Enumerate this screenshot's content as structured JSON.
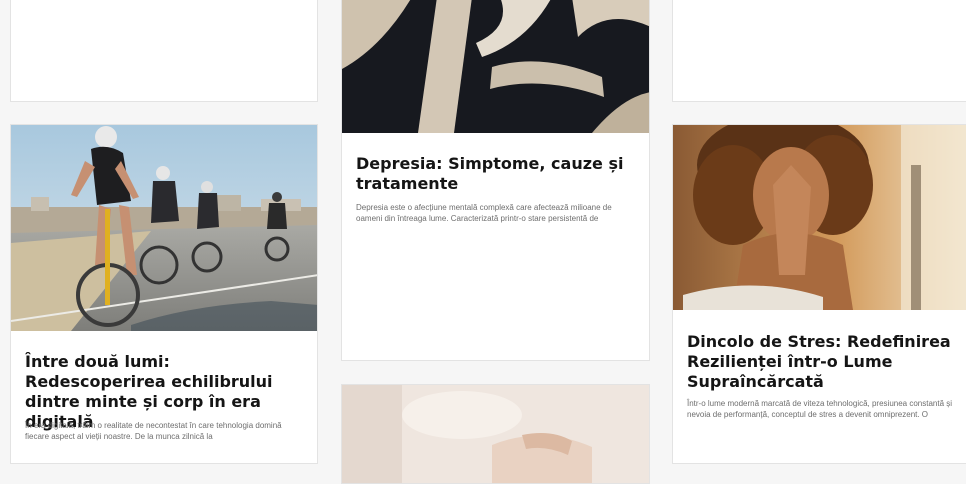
{
  "articles": [
    {
      "title": "Depresia: Simptome, cauze și tratamente",
      "excerpt": "Depresia este o afecțiune mentală complexă care afectează milioane de oameni din întreaga lume. Caracterizată printr-o stare persistentă de",
      "image": "abstract-dark-shape"
    },
    {
      "title": "Între două lumi: Redescoperirea echilibrului dintre minte și corp în era digitală",
      "excerpt": "În era digitală, trăim o realitate de necontestat în care tehnologia domină fiecare aspect al vieții noastre. De la munca zilnică la",
      "image": "cyclists-on-road"
    },
    {
      "title": "Dincolo de Stres: Redefinirea Rezilienței într-o Lume Supraîncărcată",
      "excerpt": "Într-o lume modernă marcată de viteza tehnologică, presiunea constantă și nevoia de performanță, conceptul de stres a devenit omniprezent. O",
      "image": "woman-hands-clasped"
    },
    {
      "image": "hands-light-background"
    }
  ],
  "colors": {
    "background": "#f6f6f6",
    "card": "#ffffff",
    "title": "#151515",
    "excerpt": "#6e6e6e"
  }
}
